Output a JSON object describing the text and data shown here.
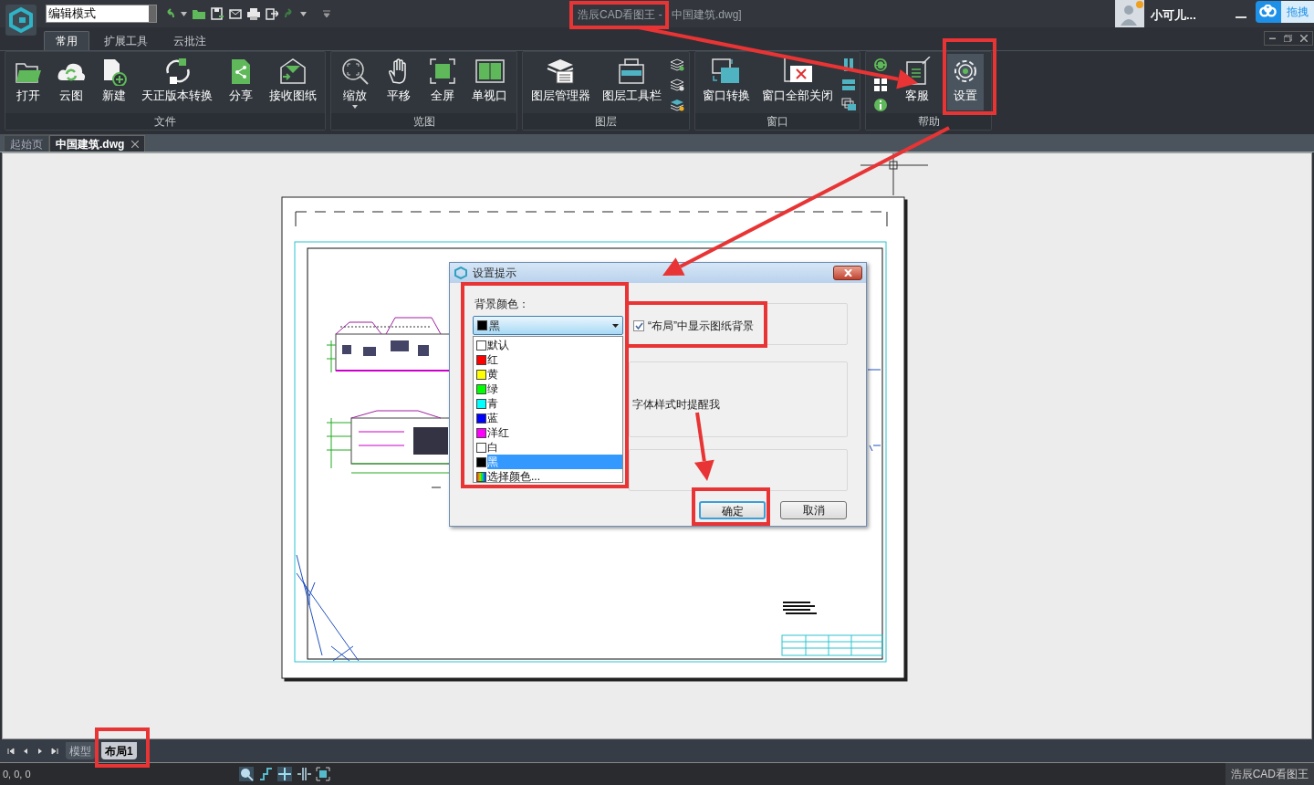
{
  "title_bar": {
    "mode_field": "编辑模式",
    "title": "浩辰CAD看图王 -",
    "title_rest": "中国建筑.dwg]",
    "user_name": "小可儿...",
    "cloud_button": "拖拽"
  },
  "ribbon_tabs": [
    {
      "label": "常用",
      "selected": true
    },
    {
      "label": "扩展工具",
      "selected": false
    },
    {
      "label": "云批注",
      "selected": false
    }
  ],
  "ribbon_groups": [
    {
      "label": "文件",
      "buttons": [
        {
          "kind": "large",
          "label": "打开",
          "dropdown": false,
          "active": false
        },
        {
          "kind": "large",
          "label": "云图",
          "dropdown": false,
          "active": false
        },
        {
          "kind": "large",
          "label": "新建",
          "dropdown": false,
          "active": false
        },
        {
          "kind": "large",
          "label": "天正版本转换",
          "dropdown": false,
          "active": false
        },
        {
          "kind": "large",
          "label": "分享",
          "dropdown": false,
          "active": false
        },
        {
          "kind": "large",
          "label": "接收图纸",
          "dropdown": false,
          "active": false
        }
      ]
    },
    {
      "label": "览图",
      "buttons": [
        {
          "kind": "large",
          "label": "缩放",
          "dropdown": true,
          "active": false
        },
        {
          "kind": "large",
          "label": "平移",
          "dropdown": false,
          "active": false
        },
        {
          "kind": "large",
          "label": "全屏",
          "dropdown": false,
          "active": false
        },
        {
          "kind": "large",
          "label": "单视口",
          "dropdown": false,
          "active": false
        }
      ]
    },
    {
      "label": "图层",
      "buttons": [
        {
          "kind": "large",
          "label": "图层管理器",
          "dropdown": false,
          "active": false
        },
        {
          "kind": "large",
          "label": "图层工具栏",
          "dropdown": false,
          "active": false
        },
        {
          "kind": "stack"
        }
      ]
    },
    {
      "label": "窗口",
      "buttons": [
        {
          "kind": "large",
          "label": "窗口转换",
          "dropdown": false,
          "active": false
        },
        {
          "kind": "large",
          "label": "窗口全部关闭",
          "dropdown": false,
          "active": false
        },
        {
          "kind": "stack"
        }
      ]
    },
    {
      "label": "帮助",
      "buttons": [
        {
          "kind": "stack"
        },
        {
          "kind": "large",
          "label": "客服",
          "dropdown": false,
          "active": false
        },
        {
          "kind": "large",
          "label": "设置",
          "dropdown": false,
          "active": true
        }
      ]
    }
  ],
  "doc_tabs": [
    {
      "label": "起始页",
      "selected": false
    },
    {
      "label": "中国建筑.dwg",
      "selected": true
    }
  ],
  "dialog": {
    "title": "设置提示",
    "bg_label": "背景颜色：",
    "dropdown": {
      "value": "黑",
      "color": "#000000"
    },
    "options": [
      {
        "kind": "swatch",
        "label": "默认",
        "color": "#ffffff",
        "selected": false
      },
      {
        "kind": "swatch",
        "label": "红",
        "color": "#ff0000",
        "selected": false
      },
      {
        "kind": "swatch",
        "label": "黄",
        "color": "#ffff00",
        "selected": false
      },
      {
        "kind": "swatch",
        "label": "绿",
        "color": "#00ff00",
        "selected": false
      },
      {
        "kind": "swatch",
        "label": "青",
        "color": "#00ffff",
        "selected": false
      },
      {
        "kind": "swatch",
        "label": "蓝",
        "color": "#0000ff",
        "selected": false
      },
      {
        "kind": "swatch",
        "label": "洋红",
        "color": "#ff00ff",
        "selected": false
      },
      {
        "kind": "swatch",
        "label": "白",
        "color": "#ffffff",
        "selected": false
      },
      {
        "kind": "swatch",
        "label": "黑",
        "color": "#000000",
        "selected": true
      },
      {
        "kind": "spectrum",
        "label": "选择颜色...",
        "selected": false
      }
    ],
    "checkbox": {
      "label": "“布局”中显示图纸背景",
      "checked": true
    },
    "partial_text": "字体样式时提醒我",
    "buttons": [
      {
        "label": "确定",
        "default": true
      },
      {
        "label": "取消",
        "default": false
      }
    ]
  },
  "layout_tabs": [
    {
      "label": "模型",
      "selected": false
    },
    {
      "label": "布局1",
      "selected": true
    }
  ],
  "status_bar": {
    "coordinates": "0, 0, 0",
    "app_name": "浩辰CAD看图王"
  }
}
